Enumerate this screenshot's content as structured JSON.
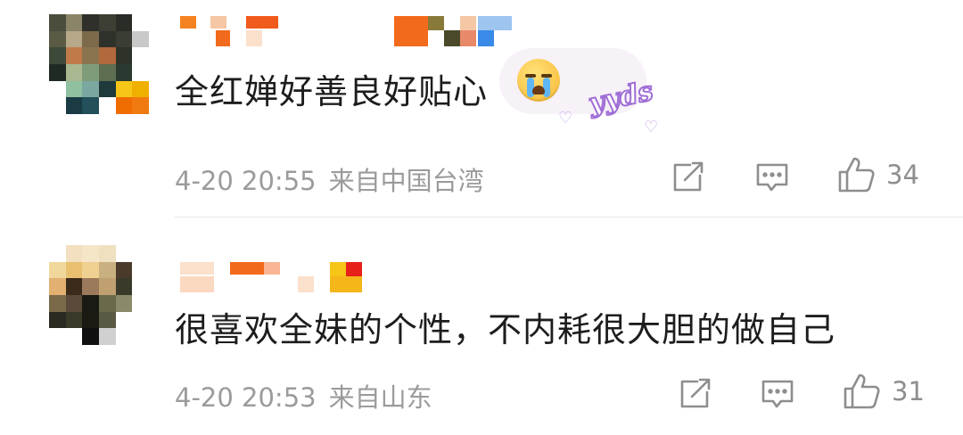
{
  "comments": [
    {
      "text": "全红婵好善良好贴心",
      "sticker_text": "yyds",
      "time": "4-20 20:55",
      "location": "来自中国台湾",
      "likes": "34"
    },
    {
      "text": "很喜欢全妹的个性，不内耗很大胆的做自己",
      "time": "4-20 20:53",
      "location": "来自山东",
      "likes": "31"
    }
  ],
  "icons": {
    "share": "share-icon",
    "reply": "comment-icon",
    "like": "thumbs-up-icon",
    "emoji": "crying-face-icon"
  },
  "colors": {
    "meta_text": "#9b9b9b",
    "icon": "#8e8e8e",
    "sticker_outline": "#a06fd6"
  }
}
